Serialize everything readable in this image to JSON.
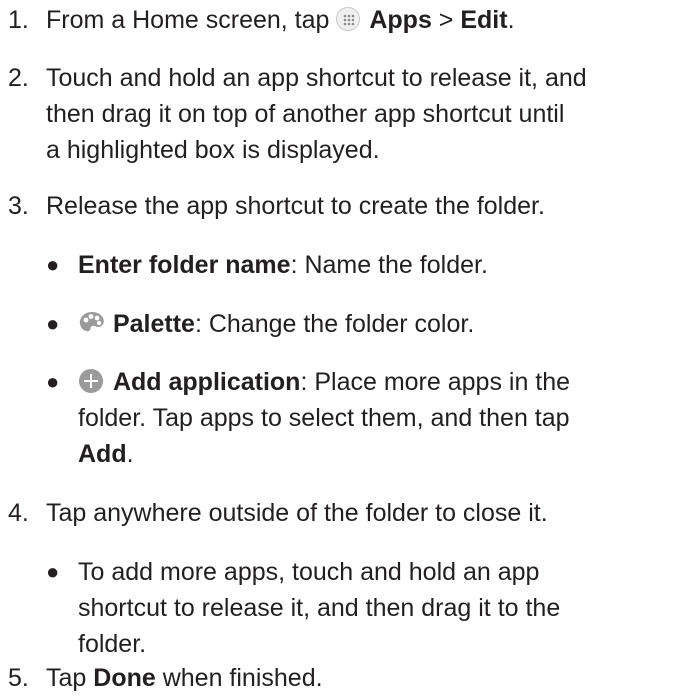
{
  "steps": [
    {
      "number": "1.",
      "pre": "From a Home screen, tap ",
      "icon": "apps-grid-icon",
      "bold1": "Apps",
      "mid": " > ",
      "bold2": "Edit",
      "post": "."
    },
    {
      "number": "2.",
      "lines": [
        "Touch and hold an app shortcut to release it, and",
        "then drag it on top of another app shortcut until",
        "a highlighted box is displayed."
      ]
    },
    {
      "number": "3.",
      "text": "Release the app shortcut to create the folder.",
      "bullets": [
        {
          "bold": "Enter folder name",
          "text": ": Name the folder."
        },
        {
          "icon": "palette-icon",
          "bold": "Palette",
          "text": ": Change the folder color."
        },
        {
          "icon": "add-icon",
          "bold": "Add application",
          "line1": ": Place more apps in the",
          "line2": "folder. Tap apps to select them, and then tap",
          "bold_end": "Add",
          "end": "."
        }
      ]
    },
    {
      "number": "4.",
      "text": "Tap anywhere outside of the folder to close it.",
      "bullets": [
        {
          "lines": [
            "To add more apps, touch and hold an app",
            "shortcut to release it, and then drag it to the",
            "folder."
          ]
        }
      ]
    },
    {
      "number": "5.",
      "pre": "Tap ",
      "bold": "Done",
      "post": " when finished."
    }
  ],
  "bullet_glyph": "●",
  "colors": {
    "text": "#231f20",
    "icon_gray": "#9a9a9a"
  }
}
